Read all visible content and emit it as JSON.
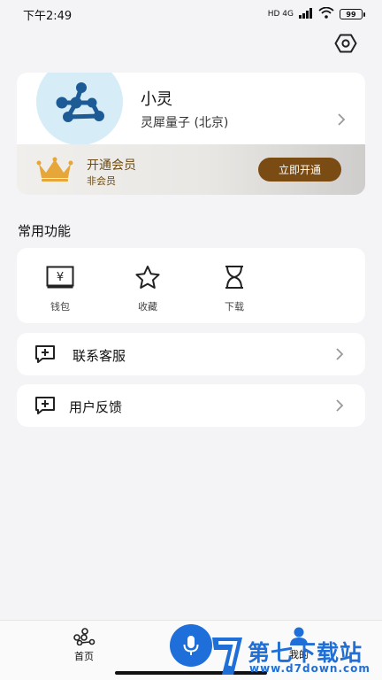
{
  "status_bar": {
    "time": "下午2:49",
    "network": "HD 4G",
    "battery": "99"
  },
  "profile": {
    "name": "小灵",
    "org": "灵犀量子 (北京)",
    "avatar_color": "#d6ecf7",
    "logo_color": "#1d5b97"
  },
  "vip": {
    "title": "开通会员",
    "status": "非会员",
    "button": "立即开通",
    "accent": "#7a4b12"
  },
  "common_functions": {
    "title": "常用功能",
    "items": [
      {
        "label": "钱包",
        "icon": "wallet-icon"
      },
      {
        "label": "收藏",
        "icon": "star-icon"
      },
      {
        "label": "下载",
        "icon": "hourglass-icon"
      }
    ]
  },
  "list_items": [
    {
      "label": "联系客服",
      "icon": "chat-plus-icon"
    },
    {
      "label": "用户反馈",
      "icon": "chat-plus-icon"
    }
  ],
  "tab_bar": {
    "home_label": "首页",
    "mine_label": "我的",
    "mic_color": "#1e6fd9"
  },
  "watermark": {
    "title": "第七下载站",
    "url": "www.d7down.com"
  }
}
